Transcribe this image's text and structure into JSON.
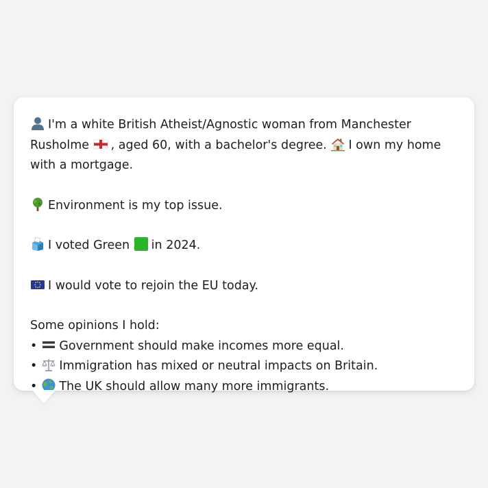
{
  "profile": {
    "intro_part1": "I'm a white British Atheist/Agnostic woman from Manchester Rusholme",
    "intro_part2": ", aged 60, with a bachelor's degree.",
    "intro_part3": "I own my home with a mortgage.",
    "top_issue": "Environment is my top issue.",
    "vote_prefix": "I voted Green",
    "vote_suffix": "in 2024.",
    "eu_stance": "I would vote to rejoin the EU today.",
    "opinions_heading": "Some opinions I hold:",
    "opinions": [
      {
        "bullet": "•",
        "icon": "equals-icon",
        "text": "Government should make incomes more equal."
      },
      {
        "bullet": "•",
        "icon": "scales-icon",
        "text": "Immigration has mixed or neutral impacts on Britain."
      },
      {
        "bullet": "•",
        "icon": "globe-icon",
        "text": "The UK should allow many more immigrants."
      }
    ]
  },
  "icons": {
    "person": "person-silhouette-icon",
    "flag": "england-flag-icon",
    "house": "house-icon",
    "tree": "tree-icon",
    "ballot": "ballot-box-icon",
    "green_square": "green-square-icon",
    "eu_flag": "eu-flag-icon"
  },
  "colors": {
    "background": "#f2f3f5",
    "card": "#ffffff",
    "text": "#1d1d1f",
    "green": "#2bb52b"
  }
}
